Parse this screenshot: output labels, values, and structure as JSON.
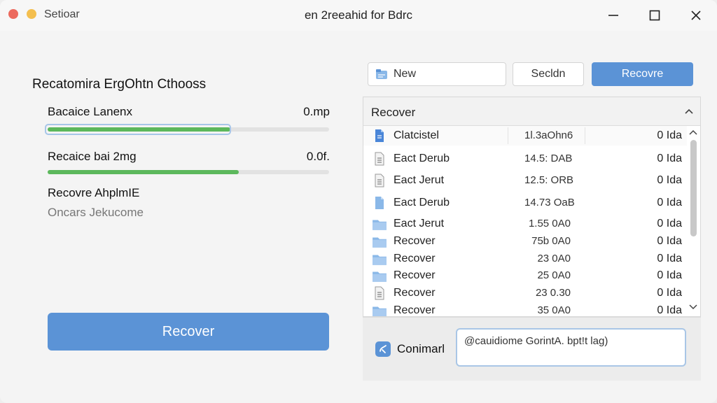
{
  "window": {
    "app_name": "Setioar",
    "title": "en 2reeahid for Bdrc"
  },
  "left_panel": {
    "section_title": "Recatomira ErgOhtn Cthooss",
    "rows": [
      {
        "label": "Bacaice Lanenx",
        "value": "0.mp",
        "progress": 0.65
      },
      {
        "label": "Recaice bai 2mg",
        "value": "0.0f.",
        "progress": 0.68
      }
    ],
    "status_title": "Recovre AhplmIE",
    "status_sub": "Oncars Jekucome",
    "recover_button": "Recover"
  },
  "toolbar": {
    "new_label": "New",
    "search_label": "Secldn",
    "recover_button": "Recovre"
  },
  "file_list": {
    "header": "Recover",
    "rows": [
      {
        "name": "Clatcistel",
        "size": "1l.3aOhn6",
        "date": "0 Ida",
        "icon": "doc-blue-icon"
      },
      {
        "name": "Eact Derub",
        "size": "14.5: DAB",
        "date": "0 Ida",
        "icon": "text-file-icon"
      },
      {
        "name": "Eact Jerut",
        "size": "12.5: ORB",
        "date": "0 Ida",
        "icon": "text-file-icon"
      },
      {
        "name": "Eact Derub",
        "size": "14.73 OaB",
        "date": "0 Ida",
        "icon": "blank-file-icon"
      },
      {
        "name": "Eact Jerut",
        "size": "1.55 0A0",
        "date": "0 Ida",
        "icon": "folder-icon"
      },
      {
        "name": "Recover",
        "size": "75b 0A0",
        "date": "0 Ida",
        "icon": "folder-icon"
      },
      {
        "name": "Recover",
        "size": "23 0A0",
        "date": "0 Ida",
        "icon": "folder-icon"
      },
      {
        "name": "Recover",
        "size": "25 0A0",
        "date": "0 Ida",
        "icon": "folder-icon"
      },
      {
        "name": "Recover",
        "size": "23 0.30",
        "date": "0 Ida",
        "icon": "text-file-icon"
      },
      {
        "name": "Recover",
        "size": "35 0A0",
        "date": "0 Ida",
        "icon": "folder-icon"
      }
    ]
  },
  "command": {
    "label": "Conimarl",
    "value": "@cauidiome GorintA. bpt!t lag)"
  },
  "colors": {
    "accent": "#5b93d6",
    "progress": "#5cb85c",
    "folder": "#8ab8e8"
  }
}
